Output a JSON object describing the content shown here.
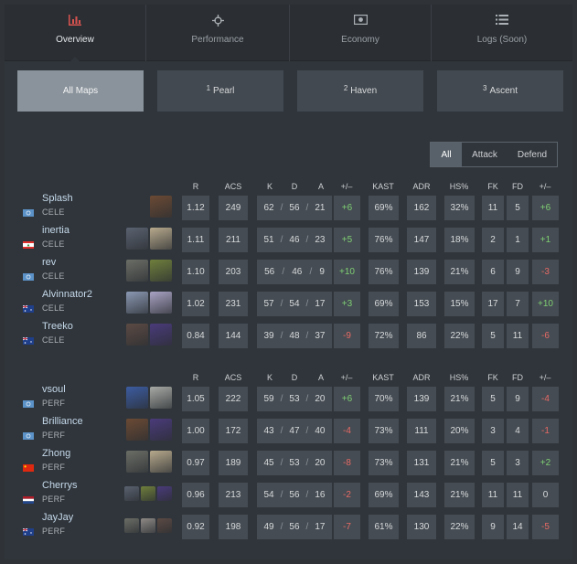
{
  "nav": {
    "tabs": [
      {
        "label": "Overview",
        "icon": "bar-chart-icon",
        "active": true
      },
      {
        "label": "Performance",
        "icon": "crosshair-icon",
        "active": false
      },
      {
        "label": "Economy",
        "icon": "money-icon",
        "active": false
      },
      {
        "label": "Logs (Soon)",
        "icon": "list-icon",
        "active": false
      }
    ]
  },
  "maps": [
    {
      "num": "",
      "label": "All Maps",
      "active": true
    },
    {
      "num": "1",
      "label": "Pearl",
      "active": false
    },
    {
      "num": "2",
      "label": "Haven",
      "active": false
    },
    {
      "num": "3",
      "label": "Ascent",
      "active": false
    }
  ],
  "side_filter": [
    "All",
    "Attack",
    "Defend"
  ],
  "columns": [
    "R",
    "ACS",
    "K",
    "D",
    "A",
    "+/–",
    "KAST",
    "ADR",
    "HS%",
    "FK",
    "FD",
    "+/–"
  ],
  "kda_sep": "/",
  "colors": {
    "accent": "#d9534f",
    "positive": "#7fcf73",
    "negative": "#e76a65"
  },
  "teams": [
    {
      "players": [
        {
          "name": "Splash",
          "team": "CELE",
          "flag": "un",
          "agents": [
            {
              "icon": "agent-dark",
              "c": "#6b4a34"
            }
          ],
          "r": "1.12",
          "acs": "249",
          "k": "62",
          "d": "56",
          "a": "21",
          "pm": "+6",
          "kast": "69%",
          "adr": "162",
          "hs": "32%",
          "fk": "11",
          "fd": "5",
          "fpm": "+6"
        },
        {
          "name": "inertia",
          "team": "CELE",
          "flag": "lb",
          "agents": [
            {
              "icon": "agent-grey",
              "c": "#5a6270"
            },
            {
              "icon": "agent-light",
              "c": "#b7a98c"
            }
          ],
          "r": "1.11",
          "acs": "211",
          "k": "51",
          "d": "46",
          "a": "23",
          "pm": "+5",
          "kast": "76%",
          "adr": "147",
          "hs": "18%",
          "fk": "2",
          "fd": "1",
          "fpm": "+1"
        },
        {
          "name": "rev",
          "team": "CELE",
          "flag": "un",
          "agents": [
            {
              "icon": "agent-grey",
              "c": "#6b6e66"
            },
            {
              "icon": "agent-green",
              "c": "#6f7f3c"
            }
          ],
          "r": "1.10",
          "acs": "203",
          "k": "56",
          "d": "46",
          "a": "9",
          "pm": "+10",
          "kast": "76%",
          "adr": "139",
          "hs": "21%",
          "fk": "6",
          "fd": "9",
          "fpm": "-3"
        },
        {
          "name": "Alvinnator2",
          "team": "CELE",
          "flag": "au",
          "agents": [
            {
              "icon": "agent-blue",
              "c": "#8a98b2"
            },
            {
              "icon": "agent-light",
              "c": "#a9a3c4"
            }
          ],
          "r": "1.02",
          "acs": "231",
          "k": "57",
          "d": "54",
          "a": "17",
          "pm": "+3",
          "kast": "69%",
          "adr": "153",
          "hs": "15%",
          "fk": "17",
          "fd": "7",
          "fpm": "+10"
        },
        {
          "name": "Treeko",
          "team": "CELE",
          "flag": "au",
          "agents": [
            {
              "icon": "agent-dark",
              "c": "#5b4a44"
            },
            {
              "icon": "agent-purple",
              "c": "#4a3b7a"
            }
          ],
          "r": "0.84",
          "acs": "144",
          "k": "39",
          "d": "48",
          "a": "37",
          "pm": "-9",
          "kast": "72%",
          "adr": "86",
          "hs": "22%",
          "fk": "5",
          "fd": "11",
          "fpm": "-6"
        }
      ]
    },
    {
      "players": [
        {
          "name": "vsoul",
          "team": "PERF",
          "flag": "un",
          "agents": [
            {
              "icon": "agent-blue",
              "c": "#3c5ca0"
            },
            {
              "icon": "agent-light",
              "c": "#a6a9a4"
            }
          ],
          "r": "1.05",
          "acs": "222",
          "k": "59",
          "d": "53",
          "a": "20",
          "pm": "+6",
          "kast": "70%",
          "adr": "139",
          "hs": "21%",
          "fk": "5",
          "fd": "9",
          "fpm": "-4"
        },
        {
          "name": "Brilliance",
          "team": "PERF",
          "flag": "un",
          "agents": [
            {
              "icon": "agent-dark",
              "c": "#6b4a34"
            },
            {
              "icon": "agent-purple",
              "c": "#4a3b7a"
            }
          ],
          "r": "1.00",
          "acs": "172",
          "k": "43",
          "d": "47",
          "a": "40",
          "pm": "-4",
          "kast": "73%",
          "adr": "111",
          "hs": "20%",
          "fk": "3",
          "fd": "4",
          "fpm": "-1"
        },
        {
          "name": "Zhong",
          "team": "PERF",
          "flag": "cn",
          "agents": [
            {
              "icon": "agent-grey",
              "c": "#6b6e66"
            },
            {
              "icon": "agent-light",
              "c": "#b7a98c"
            }
          ],
          "r": "0.97",
          "acs": "189",
          "k": "45",
          "d": "53",
          "a": "20",
          "pm": "-8",
          "kast": "73%",
          "adr": "131",
          "hs": "21%",
          "fk": "5",
          "fd": "3",
          "fpm": "+2"
        },
        {
          "name": "Cherrys",
          "team": "PERF",
          "flag": "nl",
          "agents": [
            {
              "icon": "agent-grey",
              "c": "#5a6270"
            },
            {
              "icon": "agent-green",
              "c": "#6f7f3c"
            },
            {
              "icon": "agent-purple",
              "c": "#4a3b7a"
            }
          ],
          "r": "0.96",
          "acs": "213",
          "k": "54",
          "d": "56",
          "a": "16",
          "pm": "-2",
          "kast": "69%",
          "adr": "143",
          "hs": "21%",
          "fk": "11",
          "fd": "11",
          "fpm": "0"
        },
        {
          "name": "JayJay",
          "team": "PERF",
          "flag": "au",
          "agents": [
            {
              "icon": "agent-grey",
              "c": "#6b6e66"
            },
            {
              "icon": "agent-light",
              "c": "#8e8a86"
            },
            {
              "icon": "agent-dark",
              "c": "#5b4a44"
            }
          ],
          "r": "0.92",
          "acs": "198",
          "k": "49",
          "d": "56",
          "a": "17",
          "pm": "-7",
          "kast": "61%",
          "adr": "130",
          "hs": "22%",
          "fk": "9",
          "fd": "14",
          "fpm": "-5"
        }
      ]
    }
  ]
}
